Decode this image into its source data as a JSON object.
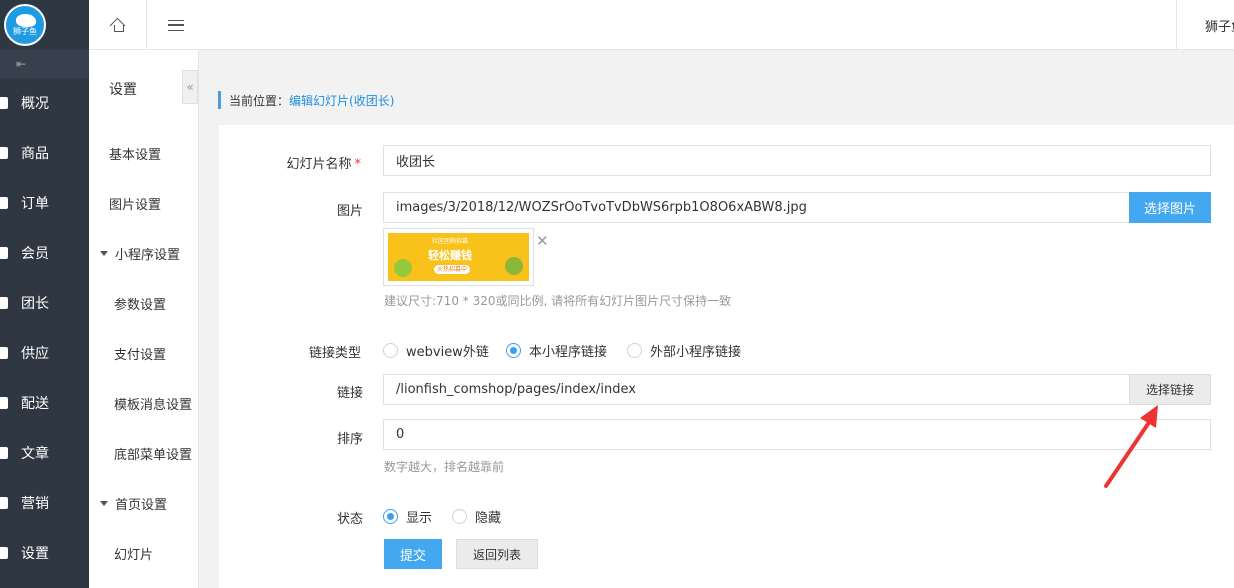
{
  "brand": {
    "logo_text": "狮子鱼"
  },
  "topbar": {
    "user_name": "狮子鱼"
  },
  "sidebar": {
    "items": [
      {
        "label": "概况",
        "icon": "home-icon"
      },
      {
        "label": "商品",
        "icon": "checkbox-icon"
      },
      {
        "label": "订单",
        "icon": "list-icon"
      },
      {
        "label": "会员",
        "icon": "users-icon"
      },
      {
        "label": "团长",
        "icon": "leader-icon"
      },
      {
        "label": "供应",
        "icon": "supply-icon"
      },
      {
        "label": "配送",
        "icon": "truck-icon"
      },
      {
        "label": "文章",
        "icon": "compass-icon"
      },
      {
        "label": "营销",
        "icon": "gift-icon"
      },
      {
        "label": "设置",
        "icon": "gear-icon"
      }
    ]
  },
  "submenu": {
    "title": "设置",
    "items": [
      {
        "label": "基本设置"
      },
      {
        "label": "图片设置"
      },
      {
        "label": "小程序设置"
      },
      {
        "label": "参数设置"
      },
      {
        "label": "支付设置"
      },
      {
        "label": "模板消息设置"
      },
      {
        "label": "底部菜单设置"
      },
      {
        "label": "首页设置"
      },
      {
        "label": "幻灯片"
      }
    ]
  },
  "breadcrumb": {
    "prefix": "当前位置：",
    "current": "编辑幻灯片(收团长)"
  },
  "form": {
    "name_label": "幻灯片名称",
    "required_mark": "*",
    "name_value": "收团长",
    "image_label": "图片",
    "image_value": "images/3/2018/12/WOZSrOoTvoTvDbWS6rpb1O8O6xABW8.jpg",
    "choose_image": "选择图片",
    "thumb_title": "社区团购招募",
    "thumb_main": "轻松赚钱",
    "thumb_btn": "火热招募中",
    "image_hint": "建议尺寸:710 * 320或同比例, 请将所有幻灯片图片尺寸保持一致",
    "link_type_label": "链接类型",
    "link_types": [
      "webview外链",
      "本小程序链接",
      "外部小程序链接"
    ],
    "link_label": "链接",
    "link_value": "/lionfish_comshop/pages/index/index",
    "choose_link": "选择链接",
    "sort_label": "排序",
    "sort_value": "0",
    "sort_hint": "数字越大，排名越靠前",
    "status_label": "状态",
    "status_options": [
      "显示",
      "隐藏"
    ],
    "submit": "提交",
    "back": "返回列表"
  },
  "colors": {
    "accent": "#44a8f0",
    "sidebar_bg": "#2f3742",
    "annotation_arrow": "#ee3333"
  }
}
